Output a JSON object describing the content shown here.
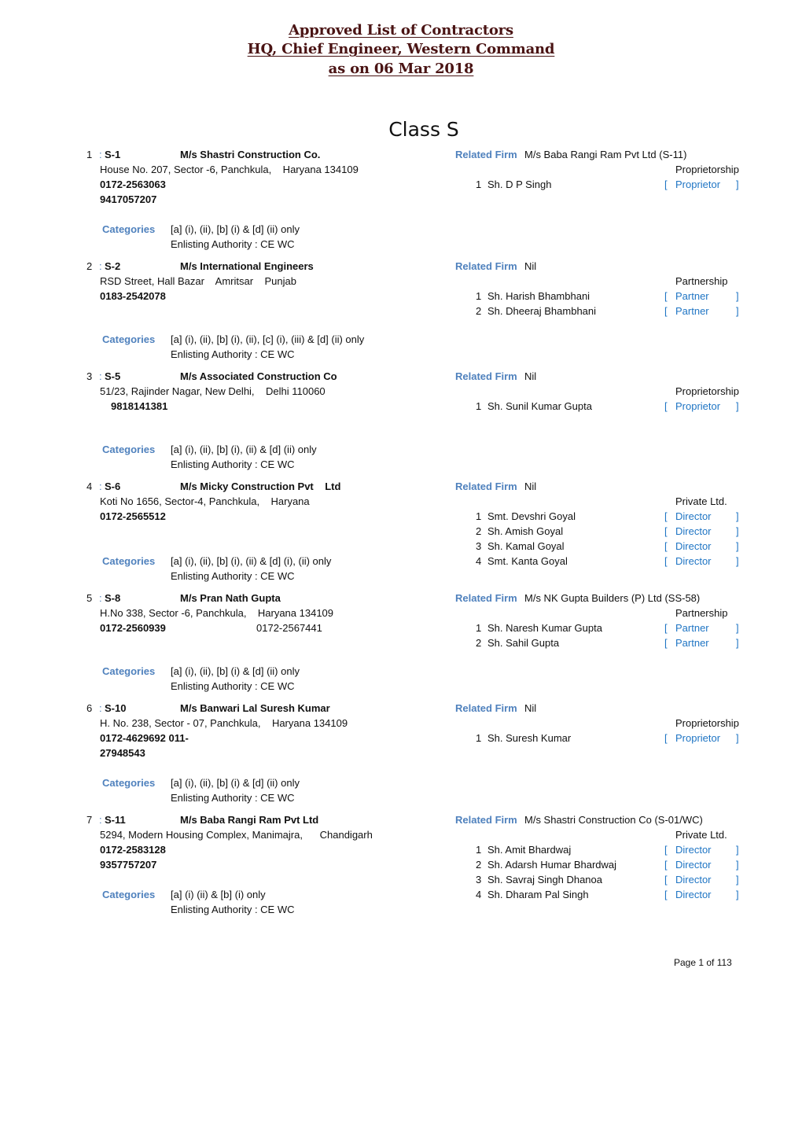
{
  "header": {
    "line1": "Approved List of Contractors",
    "line2": "HQ, Chief Engineer, Western Command",
    "line3": "as on 06 Mar 2018"
  },
  "class_title": "Class S",
  "labels": {
    "related_firm": "Related Firm",
    "categories": "Categories",
    "bracket_open": "[",
    "bracket_close": "]"
  },
  "entries": [
    {
      "index": "1",
      "sep": ":",
      "code": "S-1",
      "name": "M/s Shastri Construction Co.",
      "address": "House No. 207, Sector -6, Panchkula,    Haryana 134109",
      "phones": [
        "0172-2563063",
        "9417057207"
      ],
      "phone_alt": "",
      "related_firm": "M/s Baba Rangi Ram Pvt Ltd (S-11)",
      "firm_type": "Proprietorship",
      "members": [
        {
          "no": "1",
          "name": "Sh. D P Singh",
          "role": "Proprietor"
        }
      ],
      "categories": "[a] (i), (ii), [b] (i) & [d] (ii) only",
      "authority": "Enlisting Authority : CE WC"
    },
    {
      "index": "2",
      "sep": ":",
      "code": "S-2",
      "name": "M/s International Engineers",
      "address": "RSD Street, Hall Bazar    Amritsar    Punjab",
      "phones": [
        "0183-2542078"
      ],
      "phone_alt": "",
      "related_firm": "Nil",
      "firm_type": "Partnership",
      "members": [
        {
          "no": "1",
          "name": "Sh. Harish Bhambhani",
          "role": "Partner"
        },
        {
          "no": "2",
          "name": "Sh. Dheeraj Bhambhani",
          "role": "Partner"
        }
      ],
      "categories": "[a] (i), (ii), [b] (i), (ii), [c] (i), (iii) & [d] (ii) only",
      "authority": "Enlisting Authority : CE WC"
    },
    {
      "index": "3",
      "sep": ":",
      "code": "S-5",
      "name": "M/s Associated Construction Co",
      "address": "51/23, Rajinder Nagar, New Delhi,    Delhi 110060",
      "phones": [
        "9818141381"
      ],
      "phone_alt": "",
      "related_firm": "Nil",
      "firm_type": "Proprietorship",
      "members": [
        {
          "no": "1",
          "name": "Sh. Sunil Kumar Gupta",
          "role": "Proprietor"
        }
      ],
      "categories": "[a] (i), (ii), [b] (i), (ii) & [d] (ii) only",
      "authority": "Enlisting Authority : CE WC"
    },
    {
      "index": "4",
      "sep": ":",
      "code": "S-6",
      "name": "M/s Micky Construction Pvt    Ltd",
      "address": "Koti No 1656, Sector-4, Panchkula,    Haryana",
      "phones": [
        "0172-2565512"
      ],
      "phone_alt": "",
      "related_firm": "Nil",
      "firm_type": "Private Ltd.",
      "members": [
        {
          "no": "1",
          "name": "Smt. Devshri Goyal",
          "role": "Director"
        },
        {
          "no": "2",
          "name": "Sh. Amish Goyal",
          "role": "Director"
        },
        {
          "no": "3",
          "name": "Sh. Kamal Goyal",
          "role": "Director"
        },
        {
          "no": "4",
          "name": "Smt. Kanta Goyal",
          "role": "Director"
        }
      ],
      "categories": "[a] (i), (ii), [b] (i), (ii) & [d] (i), (ii) only",
      "authority": "Enlisting Authority : CE WC"
    },
    {
      "index": "5",
      "sep": ":",
      "code": "S-8",
      "name": "M/s Pran Nath Gupta",
      "address": "H.No 338, Sector -6, Panchkula,    Haryana 134109",
      "phones": [
        "0172-2560939"
      ],
      "phone_alt": "0172-2567441",
      "related_firm": "M/s NK Gupta Builders (P) Ltd (SS-58)",
      "firm_type": "Partnership",
      "members": [
        {
          "no": "1",
          "name": "Sh. Naresh Kumar Gupta",
          "role": "Partner"
        },
        {
          "no": "2",
          "name": "Sh. Sahil Gupta",
          "role": "Partner"
        }
      ],
      "categories": "[a] (i), (ii), [b] (i) & [d] (ii) only",
      "authority": "Enlisting Authority : CE WC"
    },
    {
      "index": "6",
      "sep": ":",
      "code": "S-10",
      "name": "M/s Banwari Lal Suresh Kumar",
      "address": "H. No. 238, Sector - 07, Panchkula,    Haryana 134109",
      "phones": [
        "0172-4629692 011-",
        "27948543"
      ],
      "phone_alt": "",
      "related_firm": "Nil",
      "firm_type": "Proprietorship",
      "members": [
        {
          "no": "1",
          "name": "Sh. Suresh Kumar",
          "role": "Proprietor"
        }
      ],
      "categories": "[a] (i), (ii), [b] (i) & [d] (ii) only",
      "authority": "Enlisting Authority : CE WC"
    },
    {
      "index": "7",
      "sep": ":",
      "code": "S-11",
      "name": "M/s Baba Rangi Ram Pvt Ltd",
      "address": "5294, Modern Housing Complex, Manimajra,      Chandigarh",
      "phones": [
        "0172-2583128",
        "9357757207"
      ],
      "phone_alt": "",
      "related_firm": "M/s Shastri Construction Co (S-01/WC)",
      "firm_type": "Private Ltd.",
      "members": [
        {
          "no": "1",
          "name": "Sh. Amit Bhardwaj",
          "role": "Director"
        },
        {
          "no": "2",
          "name": "Sh. Adarsh Humar Bhardwaj",
          "role": "Director"
        },
        {
          "no": "3",
          "name": "Sh. Savraj Singh Dhanoa",
          "role": "Director"
        },
        {
          "no": "4",
          "name": "Sh. Dharam Pal Singh",
          "role": "Director"
        }
      ],
      "categories": "[a] (i) (ii) & [b] (i) only",
      "authority": "Enlisting Authority : CE WC"
    }
  ],
  "footer": {
    "page_label": "Page 1 of 113"
  }
}
